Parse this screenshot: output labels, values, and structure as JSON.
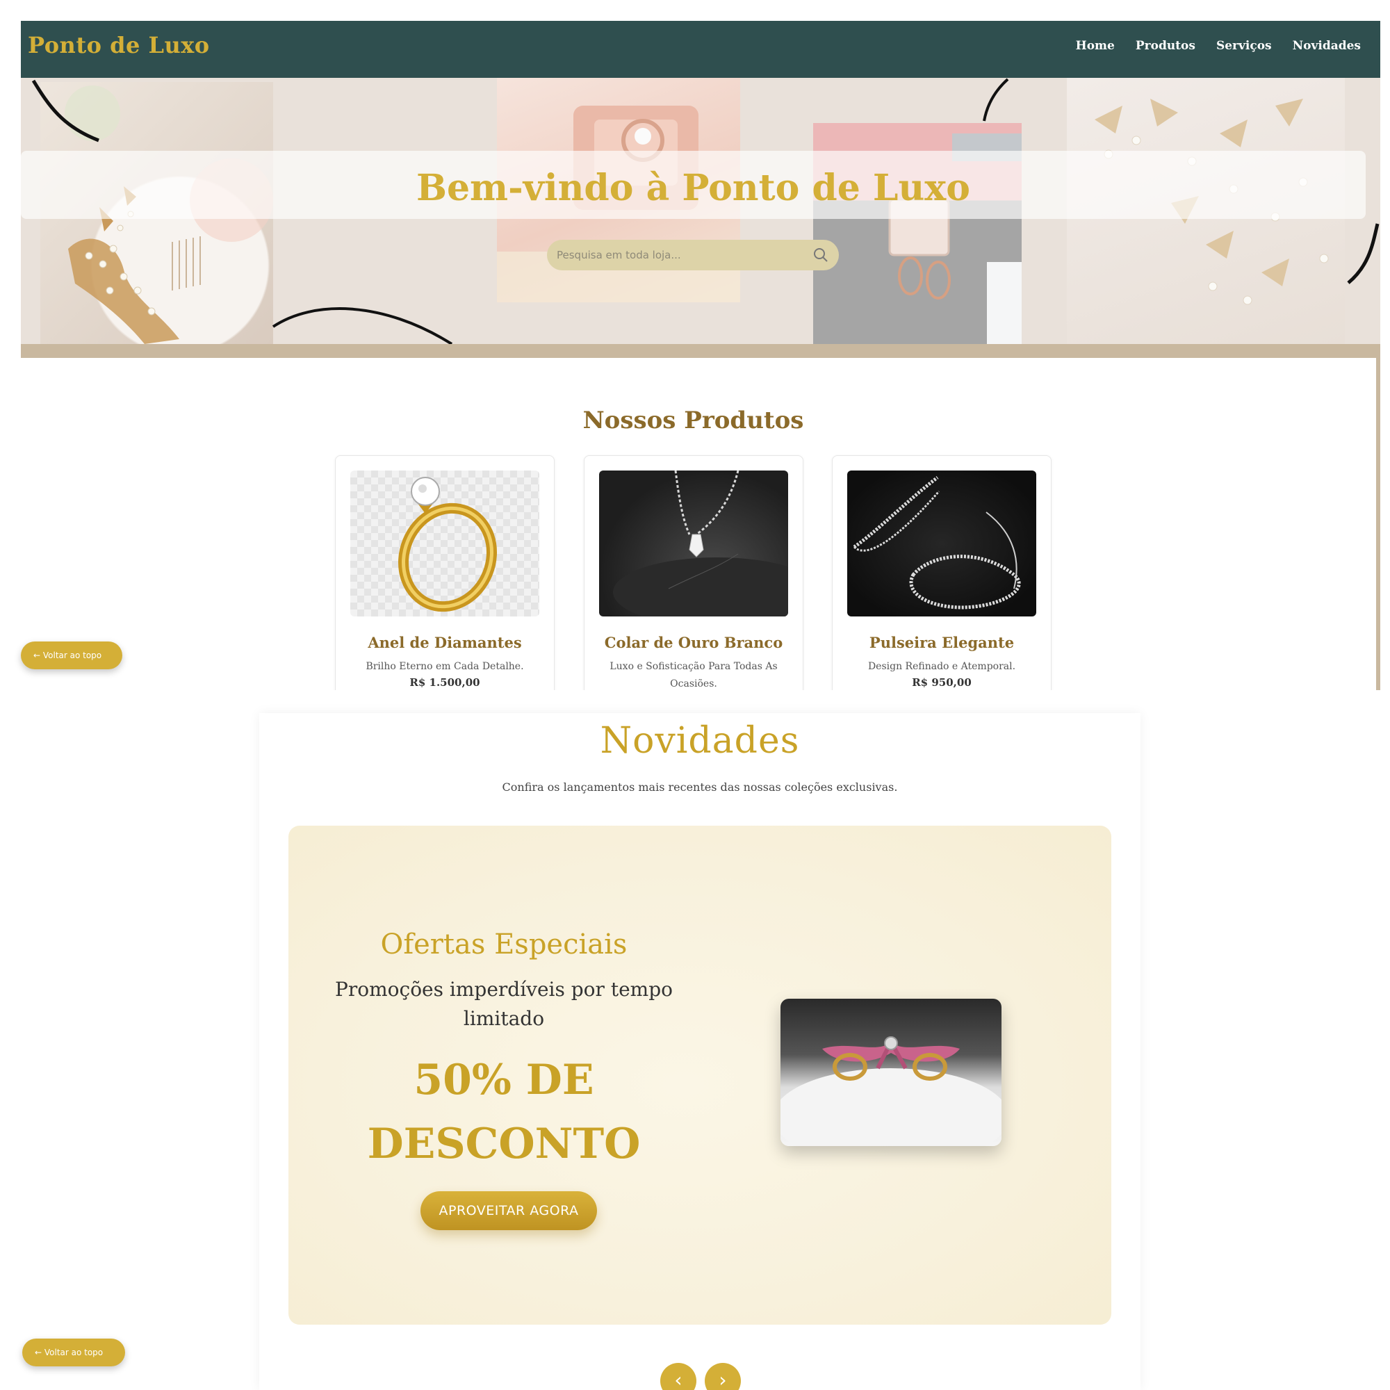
{
  "header": {
    "brand": "Ponto de Luxo",
    "nav": [
      "Home",
      "Produtos",
      "Serviços",
      "Novidades"
    ]
  },
  "hero": {
    "title": "Bem-vindo à Ponto de Luxo",
    "search_placeholder": "Pesquisa em toda loja..."
  },
  "products": {
    "section_title": "Nossos Produtos",
    "items": [
      {
        "name": "Anel de Diamantes",
        "description": "Brilho Eterno em Cada Detalhe.",
        "price": "R$ 1.500,00"
      },
      {
        "name": "Colar de Ouro Branco",
        "description": "Luxo e Sofisticação Para Todas As Ocasiões.",
        "price": ""
      },
      {
        "name": "Pulseira Elegante",
        "description": "Design Refinado e Atemporal.",
        "price": "R$ 950,00"
      }
    ]
  },
  "back_to_top": {
    "label": "← Voltar ao topo"
  },
  "novidades": {
    "title": "Novidades",
    "subtitle": "Confira os lançamentos mais recentes das nossas coleções exclusivas.",
    "promo": {
      "title": "Ofertas Especiais",
      "text": "Promoções imperdíveis por tempo limitado",
      "discount": "50% DE DESCONTO",
      "button": "APROVEITAR AGORA"
    },
    "carousel": {
      "prev": "‹",
      "next": "›"
    }
  },
  "colors": {
    "nav_bg": "#2f4f4f",
    "gold": "#d4af37",
    "brown": "#8b6a2a",
    "hero_bg": "#e9e1da",
    "promo_bg": "#f8f1dc"
  }
}
